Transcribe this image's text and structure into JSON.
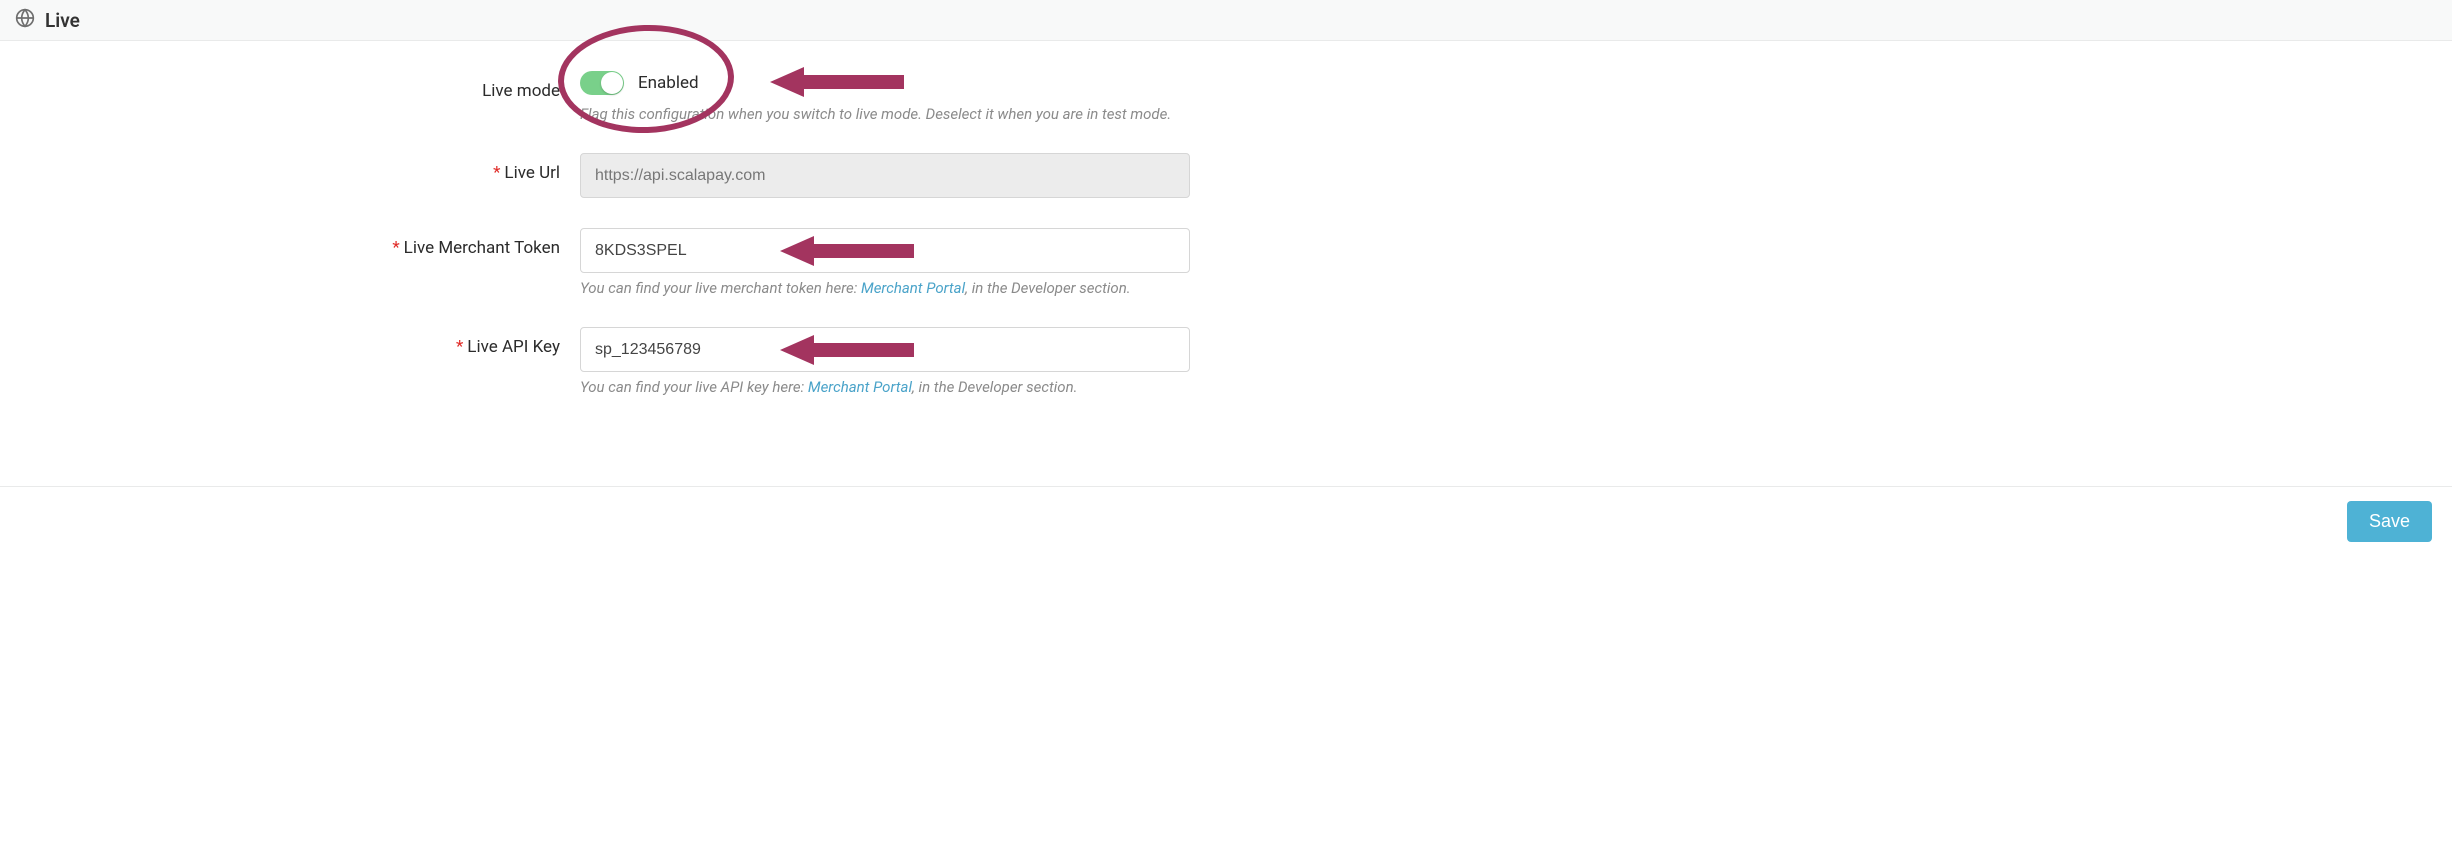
{
  "header": {
    "title": "Live"
  },
  "liveMode": {
    "label": "Live mode",
    "stateLabel": "Enabled",
    "hint": "Flag this configuration when you switch to live mode. Deselect it when you are in test mode."
  },
  "liveUrl": {
    "label": "Live Url",
    "value": "https://api.scalapay.com"
  },
  "liveToken": {
    "label": "Live Merchant Token",
    "value": "8KDS3SPEL",
    "hintPrefix": "You can find your live merchant token here: ",
    "linkText": "Merchant Portal",
    "hintSuffix": ", in the Developer section."
  },
  "liveApiKey": {
    "label": "Live API Key",
    "value": "sp_123456789",
    "hintPrefix": "You can find your live API key here: ",
    "linkText": "Merchant Portal",
    "hintSuffix": ", in the Developer section."
  },
  "footer": {
    "saveLabel": "Save"
  }
}
